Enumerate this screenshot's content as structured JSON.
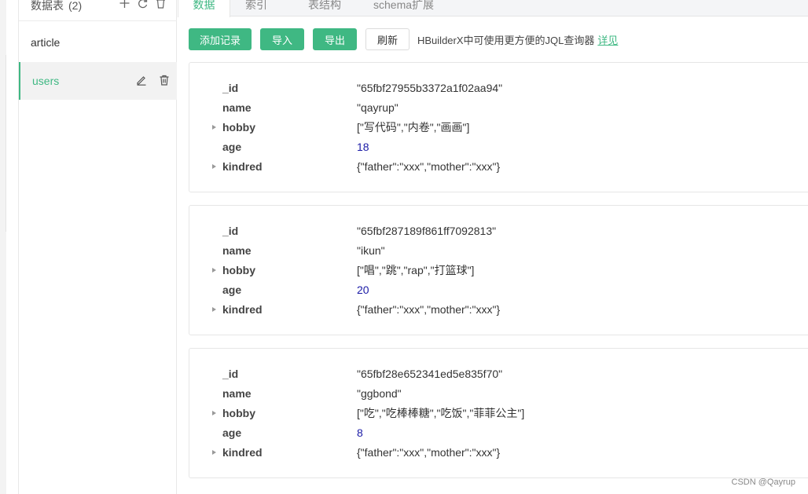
{
  "sidebar": {
    "title": "数据表",
    "count": "(2)",
    "collections": [
      {
        "name": "article"
      },
      {
        "name": "users"
      }
    ]
  },
  "tabs": [
    "数据",
    "索引",
    "表结构",
    "schema扩展"
  ],
  "toolbar": {
    "add_label": "添加记录",
    "import_label": "导入",
    "export_label": "导出",
    "refresh_label": "刷新",
    "hint": "HBuilderX中可使用更方便的JQL查询器",
    "hint_link": "详见"
  },
  "records": [
    {
      "fields": [
        {
          "key": "_id",
          "value": "\"65fbf27955b3372a1f02aa94\"",
          "expandable": false,
          "type": "string"
        },
        {
          "key": "name",
          "value": "\"qayrup\"",
          "expandable": false,
          "type": "string"
        },
        {
          "key": "hobby",
          "value": "[\"写代码\",\"内卷\",\"画画\"]",
          "expandable": true,
          "type": "array"
        },
        {
          "key": "age",
          "value": "18",
          "expandable": false,
          "type": "number"
        },
        {
          "key": "kindred",
          "value": "{\"father\":\"xxx\",\"mother\":\"xxx\"}",
          "expandable": true,
          "type": "object"
        }
      ]
    },
    {
      "fields": [
        {
          "key": "_id",
          "value": "\"65fbf287189f861ff7092813\"",
          "expandable": false,
          "type": "string"
        },
        {
          "key": "name",
          "value": "\"ikun\"",
          "expandable": false,
          "type": "string"
        },
        {
          "key": "hobby",
          "value": "[\"唱\",\"跳\",\"rap\",\"打篮球\"]",
          "expandable": true,
          "type": "array"
        },
        {
          "key": "age",
          "value": "20",
          "expandable": false,
          "type": "number"
        },
        {
          "key": "kindred",
          "value": "{\"father\":\"xxx\",\"mother\":\"xxx\"}",
          "expandable": true,
          "type": "object"
        }
      ]
    },
    {
      "fields": [
        {
          "key": "_id",
          "value": "\"65fbf28e652341ed5e835f70\"",
          "expandable": false,
          "type": "string"
        },
        {
          "key": "name",
          "value": "\"ggbond\"",
          "expandable": false,
          "type": "string"
        },
        {
          "key": "hobby",
          "value": "[\"吃\",\"吃棒棒糖\",\"吃饭\",\"菲菲公主\"]",
          "expandable": true,
          "type": "array"
        },
        {
          "key": "age",
          "value": "8",
          "expandable": false,
          "type": "number"
        },
        {
          "key": "kindred",
          "value": "{\"father\":\"xxx\",\"mother\":\"xxx\"}",
          "expandable": true,
          "type": "object"
        }
      ]
    }
  ],
  "watermark": "CSDN @Qayrup",
  "colors": {
    "accent": "#3fb883",
    "number": "#1a1aa6"
  }
}
